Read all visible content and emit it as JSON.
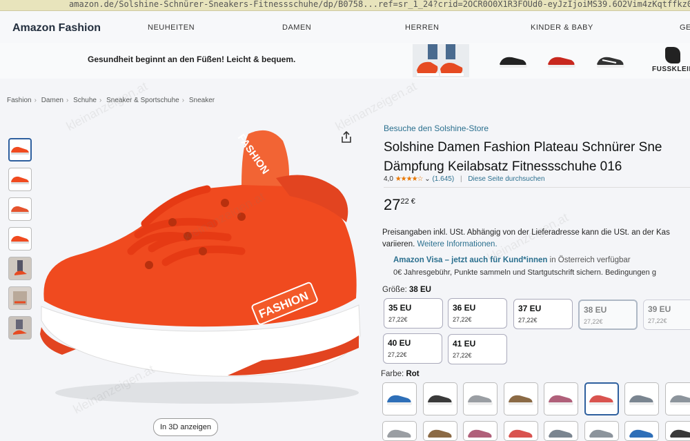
{
  "url": {
    "text": "amazon.de/Solshine-Schnürer-Sneakers-Fitnessschuhe/dp/B0758...ref=sr_1_24?crid=2OCR0O0X1R3FOUd0-eyJzIjoiMS39.6O2Vim4zKqtffkz0Xg"
  },
  "nav": {
    "brand": "Amazon Fashion",
    "links": [
      "NEUHEITEN",
      "DAMEN",
      "HERREN",
      "KINDER & BABY",
      "GES"
    ]
  },
  "promo": {
    "text": "Gesundheit beginnt an den Füßen! Leicht & bequem.",
    "brand_name": "FUSSKLEIDU"
  },
  "breadcrumb": [
    "Fashion",
    "Damen",
    "Schuhe",
    "Sneaker & Sportschuhe",
    "Sneaker"
  ],
  "product": {
    "store_link": "Besuche den Solshine-Store",
    "title_line1": "Solshine Damen Fashion Plateau Schnürer Sne",
    "title_line2": "Dämpfung Keilabsatz Fitnessschuhe 016",
    "rating_value": "4,0",
    "stars": "★★★★☆",
    "rating_count": "(1.645)",
    "search_link": "Diese Seite durchsuchen",
    "price_whole": "27",
    "price_fraction": "22 €",
    "tax_line1": "Preisangaben inkl. USt. Abhängig von der Lieferadresse kann die USt. an der Kas",
    "tax_line2": "variieren.",
    "tax_more": "Weitere Informationen.",
    "visa_title": "Amazon Visa – jetzt auch für Kund*innen",
    "visa_suffix": "in Österreich verfügbar",
    "visa_desc": "0€ Jahresgebühr, Punkte sammeln und Startgutschrift sichern. Bedingungen g",
    "size_label": "Größe:",
    "size_selected": "38 EU",
    "sizes": [
      {
        "size": "35 EU",
        "price": "27,22€"
      },
      {
        "size": "36 EU",
        "price": "27,22€"
      },
      {
        "size": "37 EU",
        "price": "27,22€"
      },
      {
        "size": "38 EU",
        "price": "27,22€"
      },
      {
        "size": "39 EU",
        "price": "27,22€"
      },
      {
        "size": "40 EU",
        "price": "27,22€"
      },
      {
        "size": "41 EU",
        "price": "27,22€"
      }
    ],
    "color_label": "Farbe:",
    "color_selected": "Rot",
    "swatch_colors": [
      "#2e6fb8",
      "#3a3a3a",
      "#9a9ea3",
      "#8b6a45",
      "#b0607a",
      "#d9534f",
      "#7a8590",
      "#8c949c"
    ],
    "view3d": "In 3D anzeigen",
    "share_icon": "share-icon",
    "accent": "#2a6f8e",
    "shoe_color": "#f04a1f"
  },
  "watermark": "kleinanzeigen.at"
}
